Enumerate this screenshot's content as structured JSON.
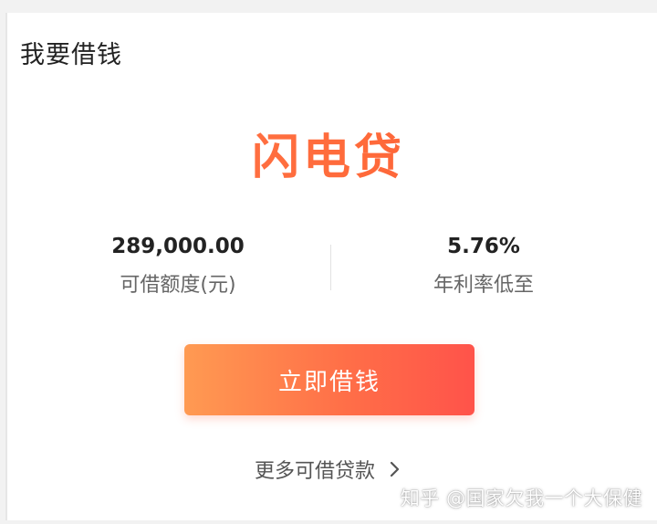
{
  "card": {
    "title": "我要借钱"
  },
  "brand": {
    "name": "闪电贷"
  },
  "stats": {
    "limit": {
      "value": "289,000.00",
      "label": "可借额度(元)"
    },
    "rate": {
      "value": "5.76%",
      "label": "年利率低至"
    }
  },
  "cta": {
    "label": "立即借钱"
  },
  "more": {
    "label": "更多可借贷款",
    "icon": "chevron-right-icon"
  },
  "watermark": {
    "text": "知乎 @国家欠我一个大保健"
  },
  "colors": {
    "brand_orange": "#ff6a3a",
    "button_start": "#ff9a52",
    "button_end": "#ff534a",
    "text_primary": "#222222",
    "text_secondary": "#666666"
  }
}
